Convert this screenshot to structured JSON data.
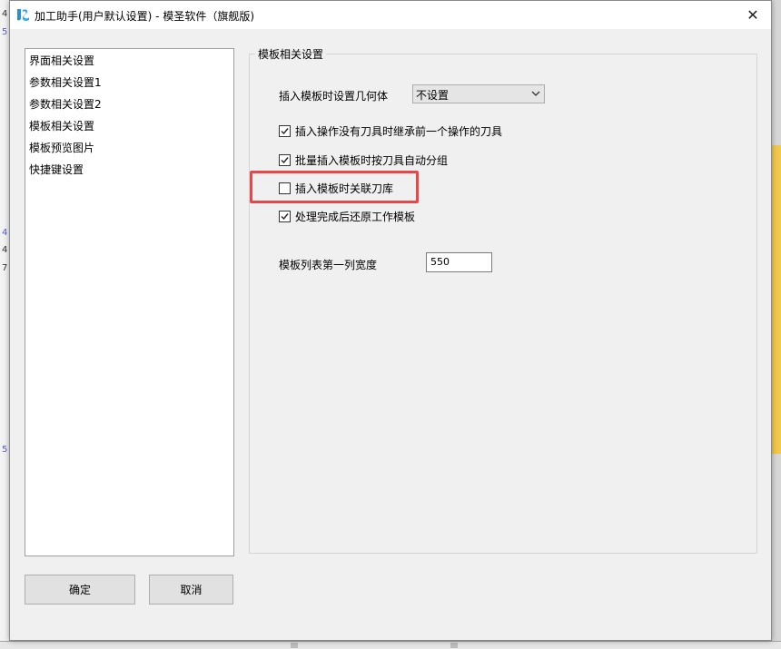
{
  "window": {
    "title": "加工助手(用户默认设置) - 模圣软件（旗舰版)",
    "close_glyph": "✕",
    "accent_color": "#e8474a"
  },
  "background": {
    "left_numbers": [
      "4",
      "5",
      "4",
      "4",
      "7",
      "5"
    ]
  },
  "sidebar": {
    "items": [
      {
        "label": "界面相关设置"
      },
      {
        "label": "参数相关设置1"
      },
      {
        "label": "参数相关设置2"
      },
      {
        "label": "模板相关设置"
      },
      {
        "label": "模板预览图片"
      },
      {
        "label": "快捷键设置"
      }
    ]
  },
  "group": {
    "title": "模板相关设置",
    "geometry_label": "插入模板时设置几何体",
    "geometry_value": "不设置",
    "checkboxes": [
      {
        "label": "插入操作没有刀具时继承前一个操作的刀具",
        "checked": true
      },
      {
        "label": "批量插入模板时按刀具自动分组",
        "checked": true
      },
      {
        "label": "插入模板时关联刀库",
        "checked": false
      },
      {
        "label": "处理完成后还原工作模板",
        "checked": true
      }
    ],
    "width_label": "模板列表第一列宽度",
    "width_value": "550"
  },
  "buttons": {
    "ok": "确定",
    "cancel": "取消"
  }
}
